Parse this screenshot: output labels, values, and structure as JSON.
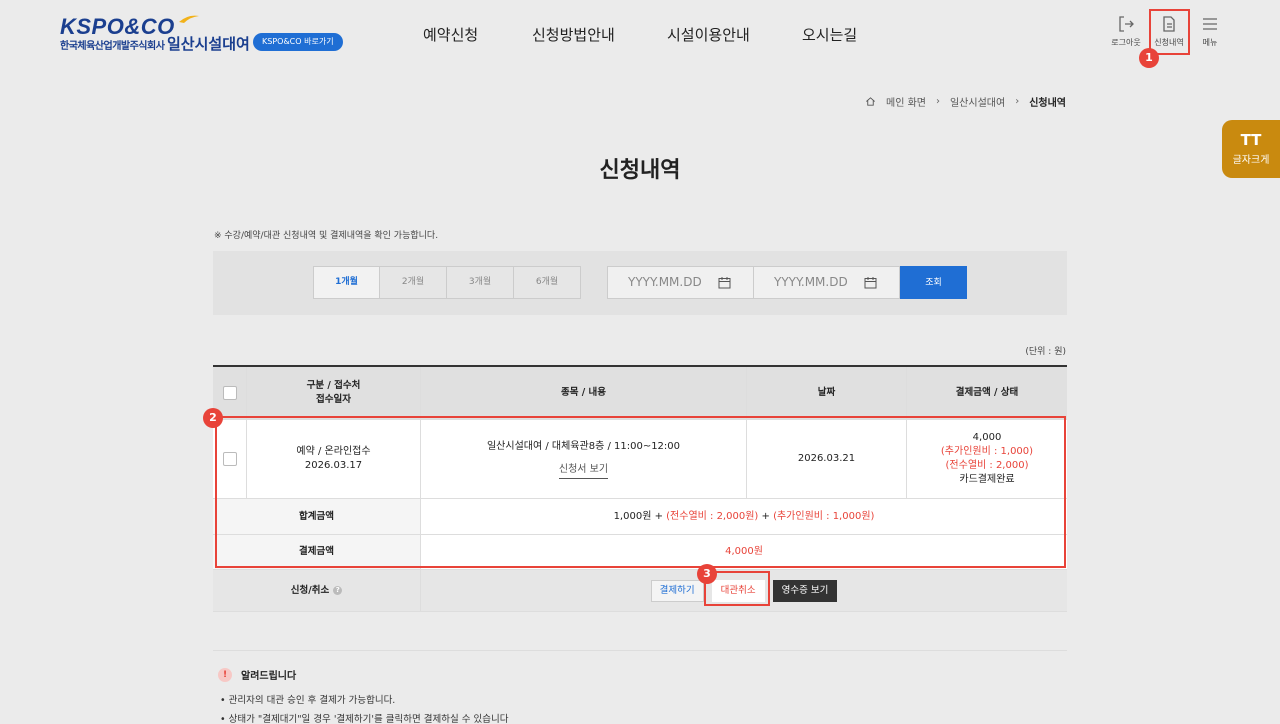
{
  "header": {
    "logo_text": "KSPO&CO",
    "logo_sub": "한국체육산업개발주식회사",
    "site_name": "일산시설대여",
    "kspo_link": "KSPO&CO 바로가기",
    "nav": [
      "예약신청",
      "신청방법안내",
      "시설이용안내",
      "오시는길"
    ],
    "util": {
      "logout": "로그아웃",
      "history": "신청내역",
      "menu": "메뉴"
    }
  },
  "breadcrumb": [
    "메인 화면",
    "일산시설대여",
    "신청내역"
  ],
  "font_size_button": {
    "icon": "TT",
    "label": "글자크게"
  },
  "page_title": "신청내역",
  "note": "※ 수강/예약/대관 신청내역 및 결제내역을 확인 가능합니다.",
  "search": {
    "periods": [
      "1개월",
      "2개월",
      "3개월",
      "6개월"
    ],
    "selected_period": "1개월",
    "start_placeholder": "YYYY.MM.DD",
    "end_placeholder": "YYYY.MM.DD",
    "search_label": "조회"
  },
  "unit_label": "(단위 : 원)",
  "table": {
    "headers": {
      "type_line1": "구분 / 접수처",
      "type_line2": "접수일자",
      "content": "종목 / 내용",
      "date": "날짜",
      "amount": "결제금액 / 상태"
    },
    "row": {
      "type": "예약 / 온라인접수",
      "received_date": "2026.03.17",
      "content": "일산시설대여 / 대체육관8층 / 11:00~12:00",
      "view_application": "신청서 보기",
      "date": "2026.03.21",
      "amount": "4,000",
      "extra_person": "(추가인원비 : 1,000)",
      "electric": "(전수열비 : 2,000)",
      "status": "카드결제완료"
    },
    "total": {
      "label": "합계금액",
      "base": "1,000원",
      "plus1": " + ",
      "electric": "(전수열비 : 2,000원)",
      "plus2": " + ",
      "extra": "(추가인원비 : 1,000원)"
    },
    "payment": {
      "label": "결제금액",
      "value": "4,000원"
    },
    "actions": {
      "label": "신청/취소",
      "help": "?",
      "pay": "결제하기",
      "cancel": "대관취소",
      "receipt": "영수증 보기"
    }
  },
  "callouts": [
    "1",
    "2",
    "3"
  ],
  "notice": {
    "icon": "!",
    "title": "알려드립니다",
    "items": [
      "• 관리자의 대관 승인 후 결제가 가능합니다.",
      "• 상태가 \"결제대기\"일 경우 '결제하기'를 클릭하면 결제하실 수 있습니다"
    ]
  },
  "colors": {
    "accent": "#1f6ed4",
    "highlight": "#e84339",
    "font_button": "#c98a0f"
  }
}
